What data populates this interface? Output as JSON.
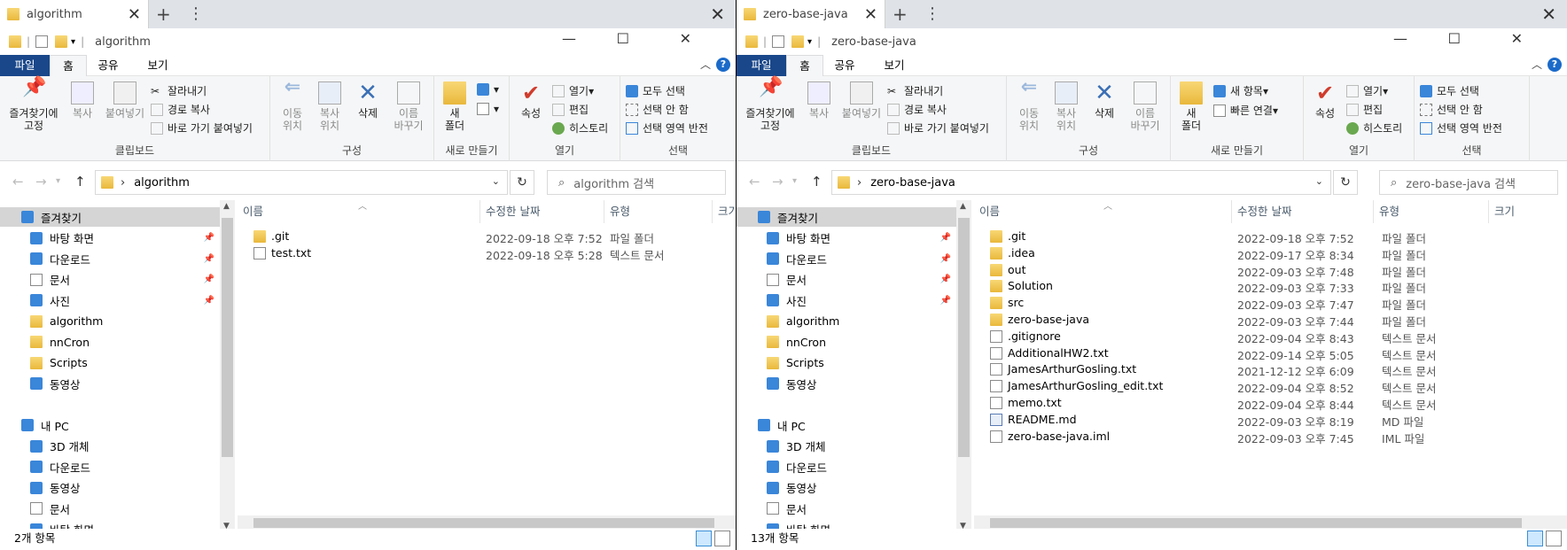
{
  "left": {
    "tab_title": "algorithm",
    "qat_title": "algorithm",
    "ribbon_tabs": [
      "파일",
      "홈",
      "공유",
      "보기"
    ],
    "clipboard": {
      "pin": "즐겨찾기에\n고정",
      "copy": "복사",
      "paste": "붙여넣기",
      "cut": "잘라내기",
      "copy_path": "경로 복사",
      "paste_shortcut": "바로 가기 붙여넣기",
      "label": "클립보드"
    },
    "organize": {
      "move": "이동\n위치",
      "copyto": "복사\n위치",
      "delete": "삭제",
      "rename": "이름\n바꾸기",
      "label": "구성"
    },
    "new": {
      "folder": "새\n폴더",
      "label": "새로 만들기"
    },
    "open": {
      "props": "속성",
      "open": "열기",
      "edit": "편집",
      "history": "히스토리",
      "label": "열기"
    },
    "select": {
      "all": "모두 선택",
      "none": "선택 안 함",
      "invert": "선택 영역 반전",
      "label": "선택"
    },
    "address": "algorithm",
    "search_placeholder": "algorithm 검색",
    "columns": [
      "이름",
      "수정한 날짜",
      "유형",
      "크기"
    ],
    "files": [
      {
        "name": ".git",
        "date": "2022-09-18 오후 7:52",
        "type": "파일 폴더",
        "icon": "folder-icon"
      },
      {
        "name": "test.txt",
        "date": "2022-09-18 오후 5:28",
        "type": "텍스트 문서",
        "icon": "text-file-icon"
      }
    ],
    "status": "2개 항목"
  },
  "right": {
    "tab_title": "zero-base-java",
    "qat_title": "zero-base-java",
    "ribbon_tabs": [
      "파일",
      "홈",
      "공유",
      "보기"
    ],
    "clipboard": {
      "pin": "즐겨찾기에\n고정",
      "copy": "복사",
      "paste": "붙여넣기",
      "cut": "잘라내기",
      "copy_path": "경로 복사",
      "paste_shortcut": "바로 가기 붙여넣기",
      "label": "클립보드"
    },
    "organize": {
      "move": "이동\n위치",
      "copyto": "복사\n위치",
      "delete": "삭제",
      "rename": "이름\n바꾸기",
      "label": "구성"
    },
    "new": {
      "folder": "새\n폴더",
      "new_item": "새 항목",
      "quick_link": "빠른 연결",
      "label": "새로 만들기"
    },
    "open": {
      "props": "속성",
      "open": "열기",
      "edit": "편집",
      "history": "히스토리",
      "label": "열기"
    },
    "select": {
      "all": "모두 선택",
      "none": "선택 안 함",
      "invert": "선택 영역 반전",
      "label": "선택"
    },
    "address": "zero-base-java",
    "search_placeholder": "zero-base-java 검색",
    "columns": [
      "이름",
      "수정한 날짜",
      "유형",
      "크기"
    ],
    "files": [
      {
        "name": ".git",
        "date": "2022-09-18 오후 7:52",
        "type": "파일 폴더",
        "icon": "folder-icon"
      },
      {
        "name": ".idea",
        "date": "2022-09-17 오후 8:34",
        "type": "파일 폴더",
        "icon": "folder-icon"
      },
      {
        "name": "out",
        "date": "2022-09-03 오후 7:48",
        "type": "파일 폴더",
        "icon": "folder-icon"
      },
      {
        "name": "Solution",
        "date": "2022-09-03 오후 7:33",
        "type": "파일 폴더",
        "icon": "folder-icon"
      },
      {
        "name": "src",
        "date": "2022-09-03 오후 7:47",
        "type": "파일 폴더",
        "icon": "folder-icon"
      },
      {
        "name": "zero-base-java",
        "date": "2022-09-03 오후 7:44",
        "type": "파일 폴더",
        "icon": "folder-icon"
      },
      {
        "name": ".gitignore",
        "date": "2022-09-04 오후 8:43",
        "type": "텍스트 문서",
        "icon": "text-file-icon"
      },
      {
        "name": "AdditionalHW2.txt",
        "date": "2022-09-14 오후 5:05",
        "type": "텍스트 문서",
        "icon": "text-file-icon"
      },
      {
        "name": "JamesArthurGosling.txt",
        "date": "2021-12-12 오후 6:09",
        "type": "텍스트 문서",
        "icon": "text-file-icon"
      },
      {
        "name": "JamesArthurGosling_edit.txt",
        "date": "2022-09-04 오후 8:52",
        "type": "텍스트 문서",
        "icon": "text-file-icon"
      },
      {
        "name": "memo.txt",
        "date": "2022-09-04 오후 8:44",
        "type": "텍스트 문서",
        "icon": "text-file-icon"
      },
      {
        "name": "README.md",
        "date": "2022-09-03 오후 8:19",
        "type": "MD 파일",
        "icon": "md-file-icon"
      },
      {
        "name": "zero-base-java.iml",
        "date": "2022-09-03 오후 7:45",
        "type": "IML 파일",
        "icon": "file-icon"
      }
    ],
    "status": "13개 항목"
  },
  "nav": [
    {
      "label": "즐겨찾기",
      "icon": "star-icon",
      "level": 1,
      "selected": true,
      "pinned": false
    },
    {
      "label": "바탕 화면",
      "icon": "desktop-icon",
      "level": 2,
      "selected": false,
      "pinned": true
    },
    {
      "label": "다운로드",
      "icon": "download-icon",
      "level": 2,
      "selected": false,
      "pinned": true
    },
    {
      "label": "문서",
      "icon": "document-icon",
      "level": 2,
      "selected": false,
      "pinned": true
    },
    {
      "label": "사진",
      "icon": "picture-icon",
      "level": 2,
      "selected": false,
      "pinned": true
    },
    {
      "label": "algorithm",
      "icon": "folder-icon",
      "level": 2,
      "selected": false,
      "pinned": false
    },
    {
      "label": "nnCron",
      "icon": "folder-icon",
      "level": 2,
      "selected": false,
      "pinned": false
    },
    {
      "label": "Scripts",
      "icon": "folder-icon",
      "level": 2,
      "selected": false,
      "pinned": false
    },
    {
      "label": "동영상",
      "icon": "video-icon",
      "level": 2,
      "selected": false,
      "pinned": false
    },
    {
      "label": "",
      "icon": "",
      "level": 0,
      "selected": false,
      "pinned": false
    },
    {
      "label": "내 PC",
      "icon": "pc-icon",
      "level": 1,
      "selected": false,
      "pinned": false
    },
    {
      "label": "3D 개체",
      "icon": "cube-icon",
      "level": 2,
      "selected": false,
      "pinned": false
    },
    {
      "label": "다운로드",
      "icon": "download-icon",
      "level": 2,
      "selected": false,
      "pinned": false
    },
    {
      "label": "동영상",
      "icon": "video-icon",
      "level": 2,
      "selected": false,
      "pinned": false
    },
    {
      "label": "문서",
      "icon": "document-icon",
      "level": 2,
      "selected": false,
      "pinned": false
    },
    {
      "label": "바탕 화면",
      "icon": "desktop-icon",
      "level": 2,
      "selected": false,
      "pinned": false
    }
  ]
}
